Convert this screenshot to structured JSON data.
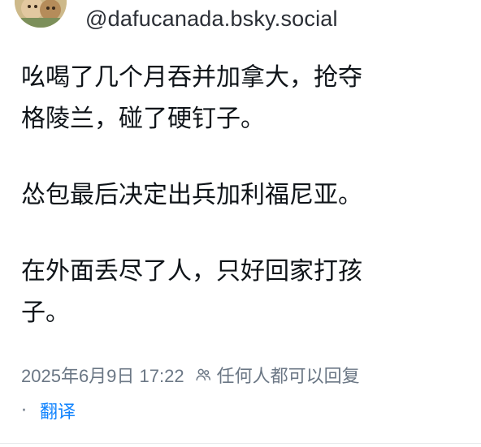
{
  "author": {
    "handle": "@dafucanada.bsky.social"
  },
  "post": {
    "paragraphs": [
      "吆喝了几个月吞并加拿大，抢夺\n格陵兰，碰了硬钉子。",
      "怂包最后决定出兵加利福尼亚。",
      "在外面丢尽了人，只好回家打孩\n子。"
    ]
  },
  "meta": {
    "timestamp": "2025年6月9日 17:22",
    "reply_setting": "任何人都可以回复",
    "separator": "·",
    "translate_label": "翻译"
  },
  "icons": {
    "reply_setting_icon": "people-icon"
  },
  "colors": {
    "text": "#0f1419",
    "secondary_text": "#6b7785",
    "link": "#1083fe"
  }
}
